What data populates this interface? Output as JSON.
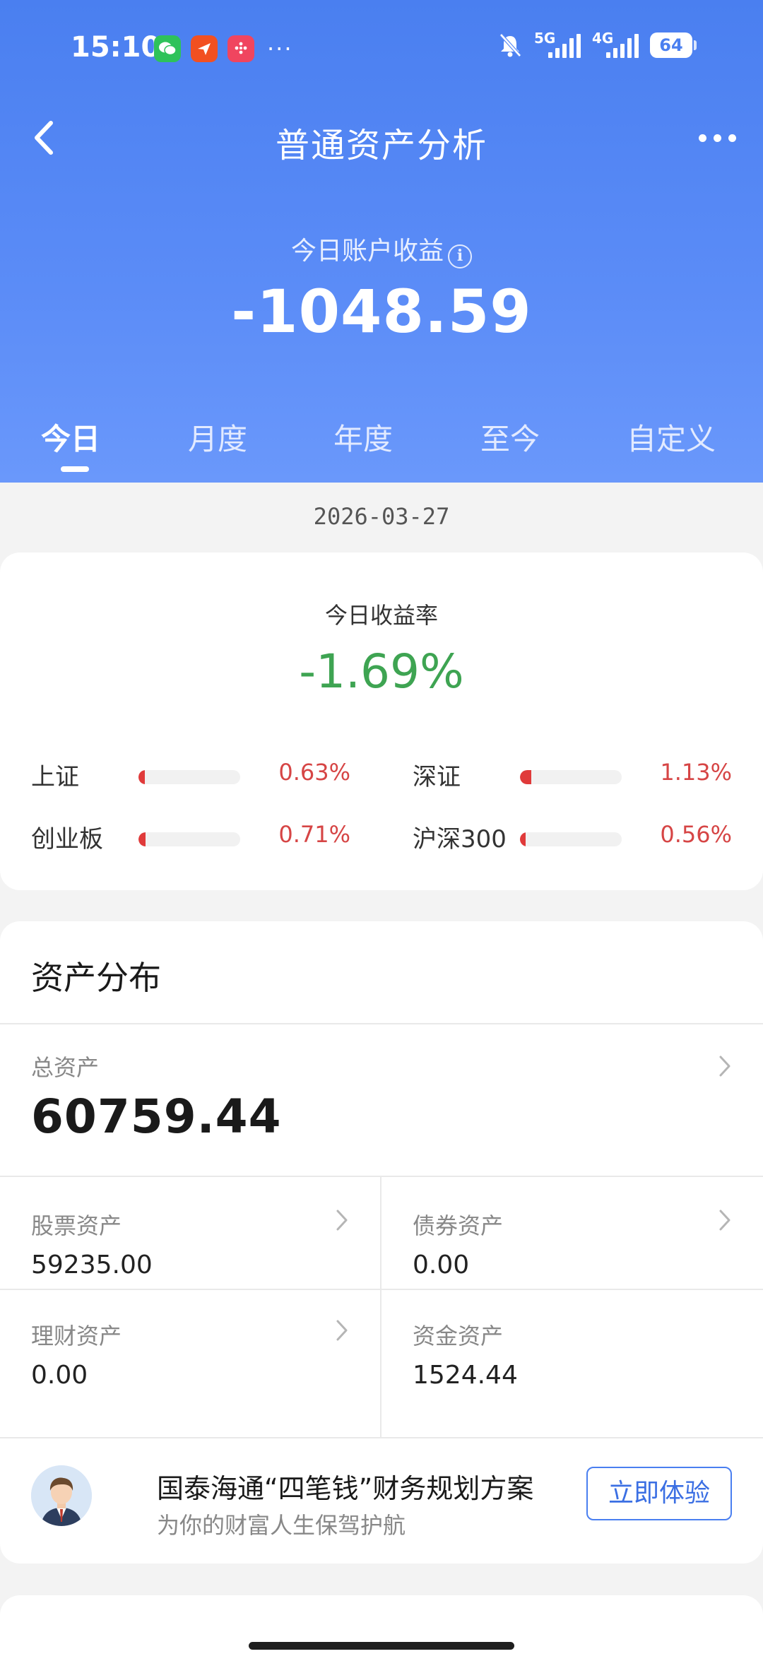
{
  "status_bar": {
    "time": "15:10",
    "notification_icons": [
      "wechat-icon",
      "send-icon",
      "app-grid-icon"
    ],
    "more": "···",
    "signal_1": "5G",
    "signal_2": "4G",
    "battery": "64"
  },
  "nav": {
    "title": "普通资产分析"
  },
  "summary": {
    "earning_label": "今日账户收益",
    "earning_value": "-1048.59"
  },
  "tabs": [
    {
      "label": "今日",
      "active": true
    },
    {
      "label": "月度",
      "active": false
    },
    {
      "label": "年度",
      "active": false
    },
    {
      "label": "至今",
      "active": false
    },
    {
      "label": "自定义",
      "active": false
    }
  ],
  "date": "2026-03-27",
  "rate": {
    "label": "今日收益率",
    "value": "-1.69%",
    "value_color": "#3ea452"
  },
  "indices": [
    {
      "name": "上证",
      "pct": "0.63%",
      "level": 0.0063
    },
    {
      "name": "深证",
      "pct": "1.13%",
      "level": 0.0113
    },
    {
      "name": "创业板",
      "pct": "0.71%",
      "level": 0.0071
    },
    {
      "name": "沪深300",
      "pct": "0.56%",
      "level": 0.0056
    }
  ],
  "assets": {
    "title": "资产分布",
    "total_label": "总资产",
    "total_value": "60759.44",
    "items": [
      {
        "label": "股票资产",
        "value": "59235.00"
      },
      {
        "label": "债券资产",
        "value": "0.00"
      },
      {
        "label": "理财资产",
        "value": "0.00"
      },
      {
        "label": "资金资产",
        "value": "1524.44"
      }
    ]
  },
  "promo": {
    "title": "国泰海通“四笔钱”财务规划方案",
    "subtitle": "为你的财富人生保驾护航",
    "button": "立即体验"
  },
  "colors": {
    "header_blue": "#5b8cf7",
    "negative_green": "#3ea452",
    "positive_red": "#d64545",
    "accent": "#3b6fe3"
  }
}
